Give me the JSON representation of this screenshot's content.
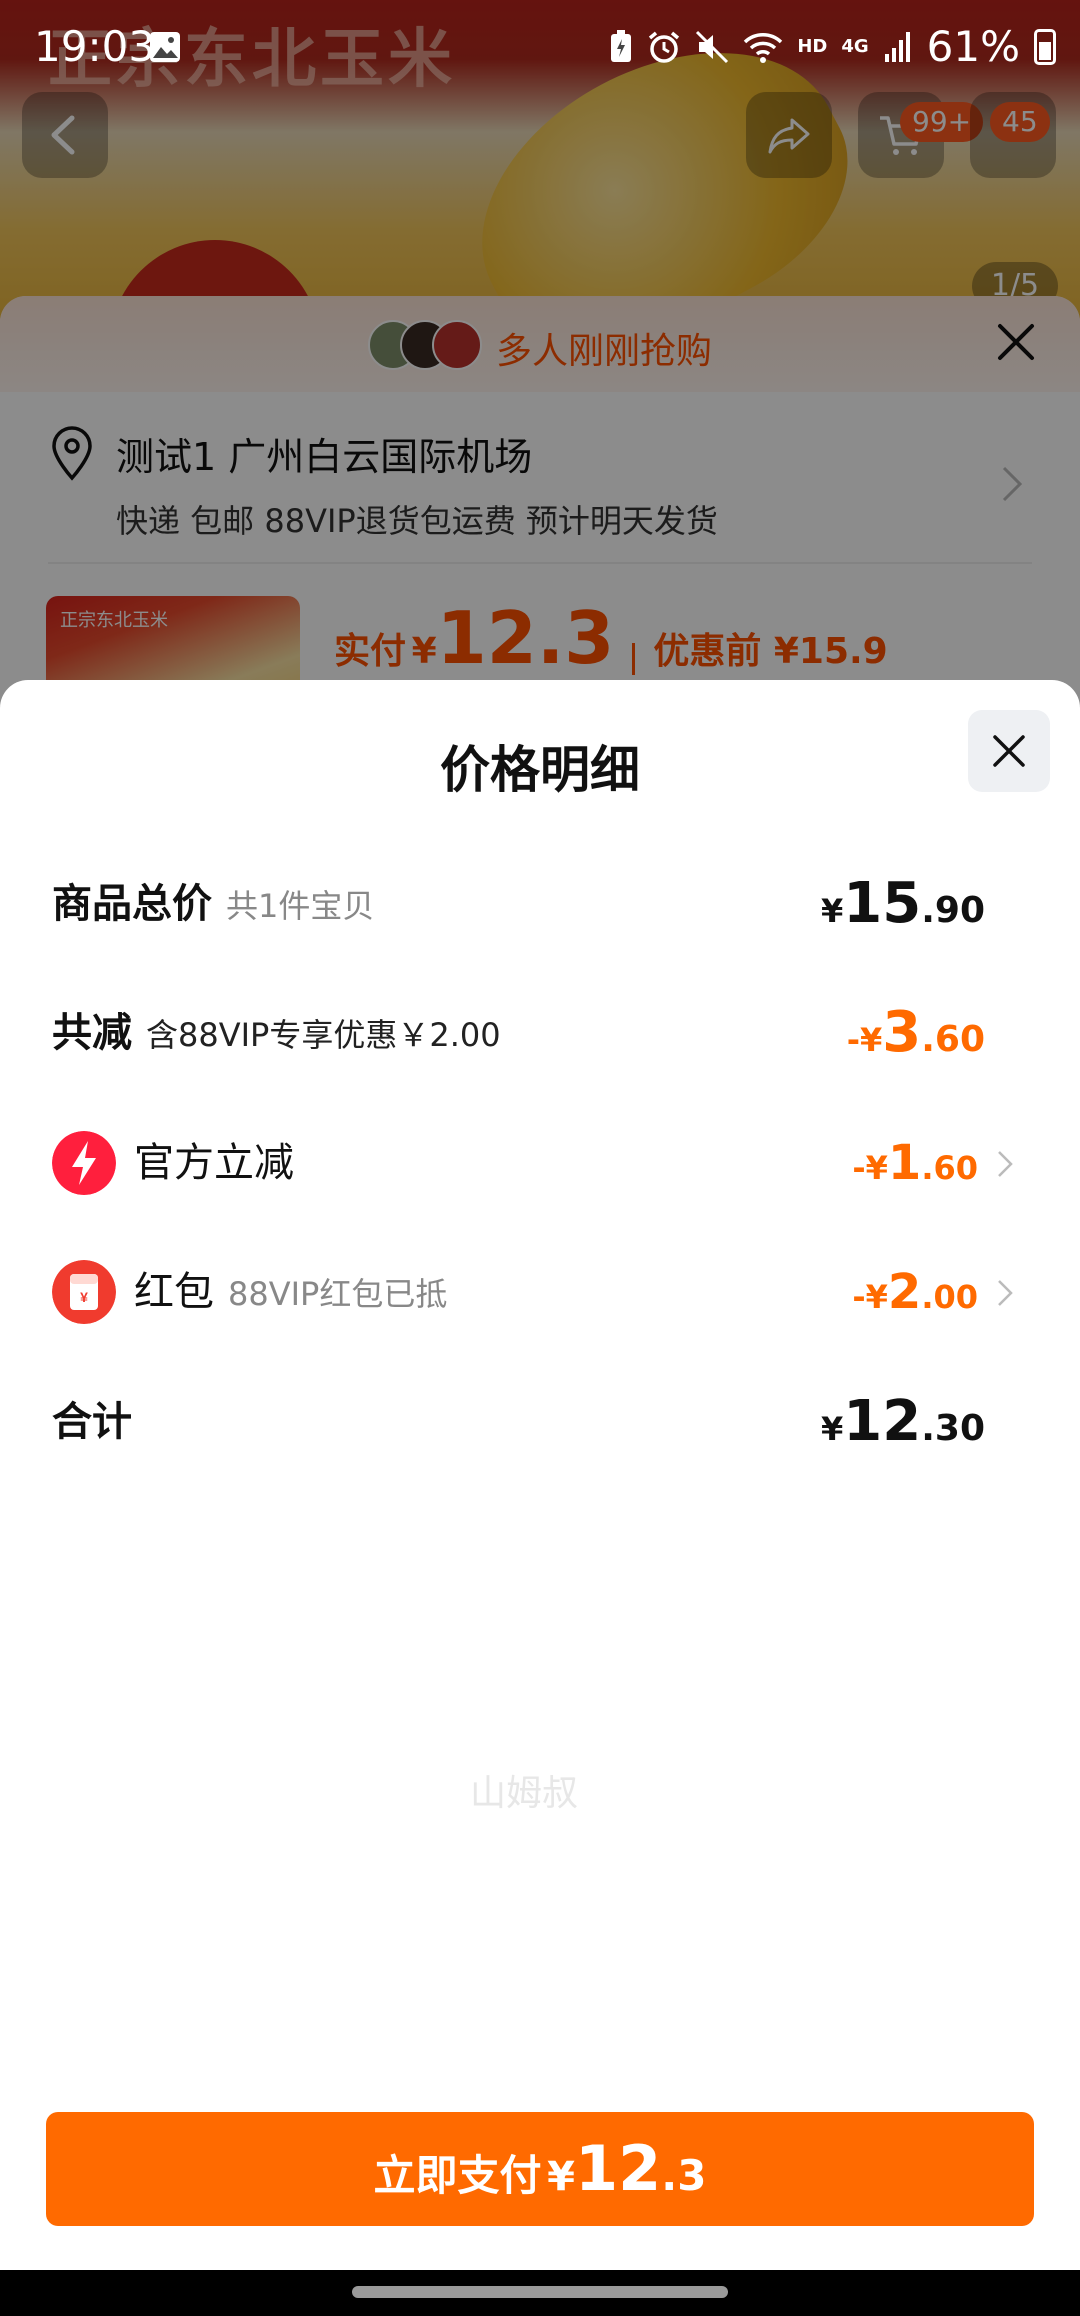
{
  "background": {
    "hero_title": "正宗东北玉米",
    "cart_badge": "99+",
    "msg_badge": "45",
    "page_indicator": "1/5",
    "grab_text": "多人刚刚抢购",
    "address": "测试1 广州白云国际机场",
    "shipping": "快递 包邮 88VIP退货包运费 预计明天发货",
    "thumb_title": "正宗东北玉米",
    "actual_pay_label": "实付",
    "actual_pay_currency": "¥",
    "actual_pay_amount": "12.3",
    "before_discount": "优惠前 ¥15.9"
  },
  "status_bar": {
    "time": "19:03",
    "network": "HD",
    "signal": "4G",
    "battery": "61%"
  },
  "sheet": {
    "title": "价格明细",
    "rows": [
      {
        "label": "商品总价",
        "sub": "共1件宝贝",
        "currency": "¥",
        "int": "15",
        "dec": ".90"
      },
      {
        "label": "共减",
        "sub": "含88VIP专享优惠￥2.00",
        "currency": "-¥",
        "int": "3",
        "dec": ".60"
      },
      {
        "label": "官方立减",
        "sub": "",
        "currency": "-¥",
        "int": "1",
        "dec": ".60"
      },
      {
        "label": "红包",
        "sub": "88VIP红包已抵",
        "currency": "-¥",
        "int": "2",
        "dec": ".00"
      },
      {
        "label": "合计",
        "sub": "",
        "currency": "¥",
        "int": "12",
        "dec": ".30"
      }
    ],
    "watermark": "山姆叔"
  },
  "pay_button": {
    "label": "立即支付",
    "currency": "¥",
    "int": "12",
    "dec": ".3"
  },
  "colors": {
    "accent": "#ff6a00",
    "lightning_icon": "#ff1f3d",
    "redpacket_icon": "#f03b2e"
  },
  "icons": [
    "back-arrow-icon",
    "share-icon",
    "cart-icon",
    "close-icon",
    "location-pin-icon",
    "chevron-right-icon",
    "lightning-icon",
    "red-packet-icon"
  ]
}
